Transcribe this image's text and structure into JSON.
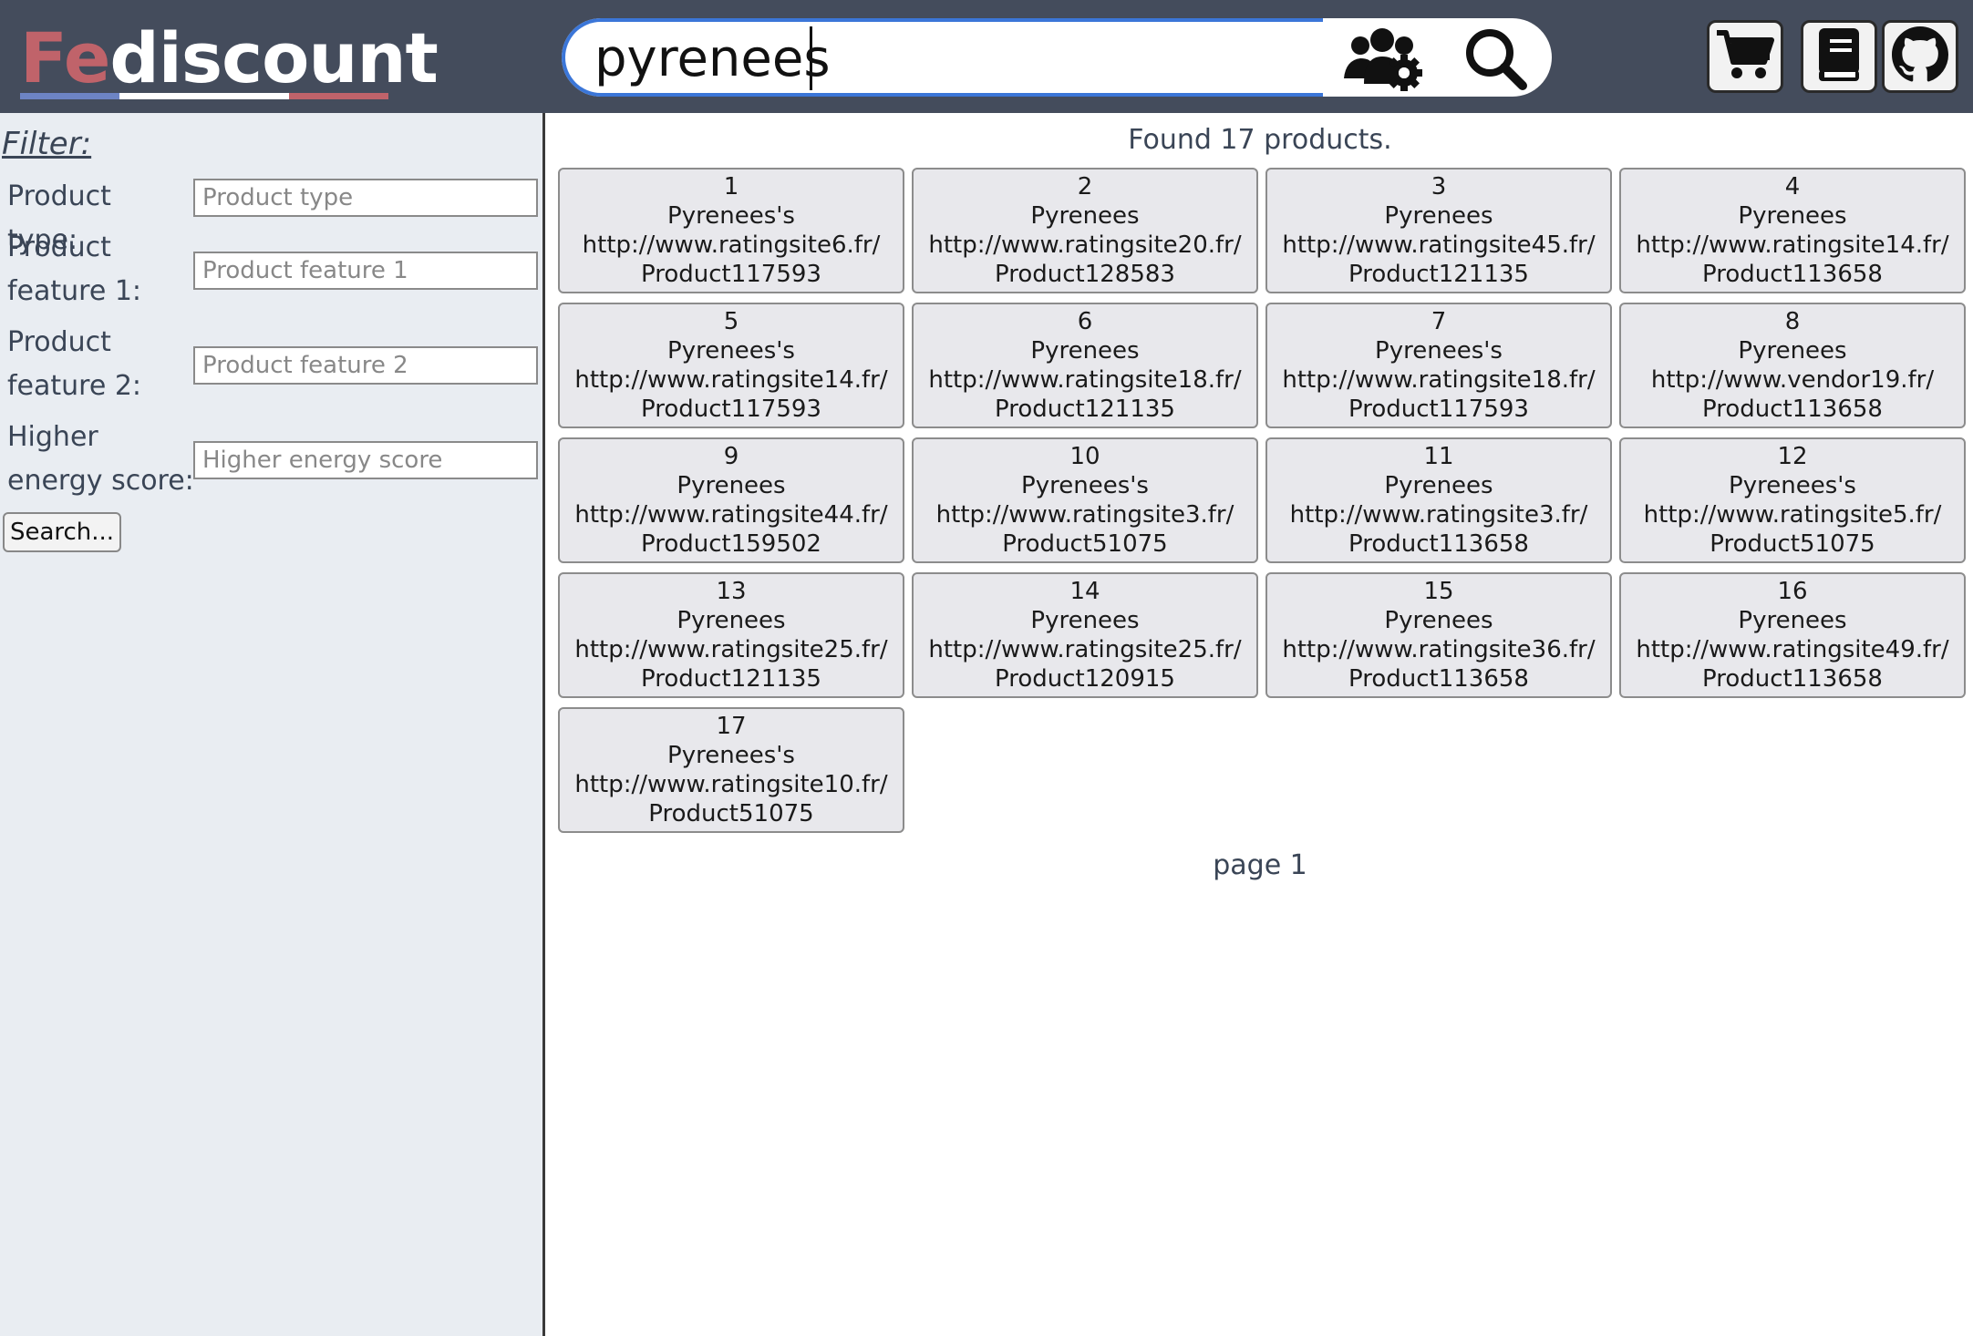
{
  "header": {
    "logo_prefix": "Fe",
    "logo_rest": "discount",
    "search_value": "pyrenees",
    "colors": {
      "background": "#444c5c",
      "logo_red": "#c0636a",
      "logo_blue": "#6d84c4",
      "search_border": "#3b76d8"
    },
    "icons": [
      "users-gear-icon",
      "search-icon",
      "cart-icon",
      "book-icon",
      "github-icon"
    ]
  },
  "sidebar": {
    "title": "Filter:",
    "fields": [
      {
        "label": "Product type:",
        "placeholder": "Product type"
      },
      {
        "label": "Product feature 1:",
        "placeholder": "Product feature 1"
      },
      {
        "label": "Product feature 2:",
        "placeholder": "Product feature 2"
      },
      {
        "label": "Higher energy score:",
        "placeholder": "Higher energy score"
      }
    ],
    "search_button": "Search..."
  },
  "results": {
    "found_text": "Found 17 products.",
    "page_label": "page 1",
    "products": [
      {
        "num": "1",
        "name": "Pyrenees's",
        "url": "http://www.ratingsite6.fr/",
        "product": "Product117593"
      },
      {
        "num": "2",
        "name": "Pyrenees",
        "url": "http://www.ratingsite20.fr/",
        "product": "Product128583"
      },
      {
        "num": "3",
        "name": "Pyrenees",
        "url": "http://www.ratingsite45.fr/",
        "product": "Product121135"
      },
      {
        "num": "4",
        "name": "Pyrenees",
        "url": "http://www.ratingsite14.fr/",
        "product": "Product113658"
      },
      {
        "num": "5",
        "name": "Pyrenees's",
        "url": "http://www.ratingsite14.fr/",
        "product": "Product117593"
      },
      {
        "num": "6",
        "name": "Pyrenees",
        "url": "http://www.ratingsite18.fr/",
        "product": "Product121135"
      },
      {
        "num": "7",
        "name": "Pyrenees's",
        "url": "http://www.ratingsite18.fr/",
        "product": "Product117593"
      },
      {
        "num": "8",
        "name": "Pyrenees",
        "url": "http://www.vendor19.fr/",
        "product": "Product113658"
      },
      {
        "num": "9",
        "name": "Pyrenees",
        "url": "http://www.ratingsite44.fr/",
        "product": "Product159502"
      },
      {
        "num": "10",
        "name": "Pyrenees's",
        "url": "http://www.ratingsite3.fr/",
        "product": "Product51075"
      },
      {
        "num": "11",
        "name": "Pyrenees",
        "url": "http://www.ratingsite3.fr/",
        "product": "Product113658"
      },
      {
        "num": "12",
        "name": "Pyrenees's",
        "url": "http://www.ratingsite5.fr/",
        "product": "Product51075"
      },
      {
        "num": "13",
        "name": "Pyrenees",
        "url": "http://www.ratingsite25.fr/",
        "product": "Product121135"
      },
      {
        "num": "14",
        "name": "Pyrenees",
        "url": "http://www.ratingsite25.fr/",
        "product": "Product120915"
      },
      {
        "num": "15",
        "name": "Pyrenees",
        "url": "http://www.ratingsite36.fr/",
        "product": "Product113658"
      },
      {
        "num": "16",
        "name": "Pyrenees",
        "url": "http://www.ratingsite49.fr/",
        "product": "Product113658"
      },
      {
        "num": "17",
        "name": "Pyrenees's",
        "url": "http://www.ratingsite10.fr/",
        "product": "Product51075"
      }
    ]
  }
}
